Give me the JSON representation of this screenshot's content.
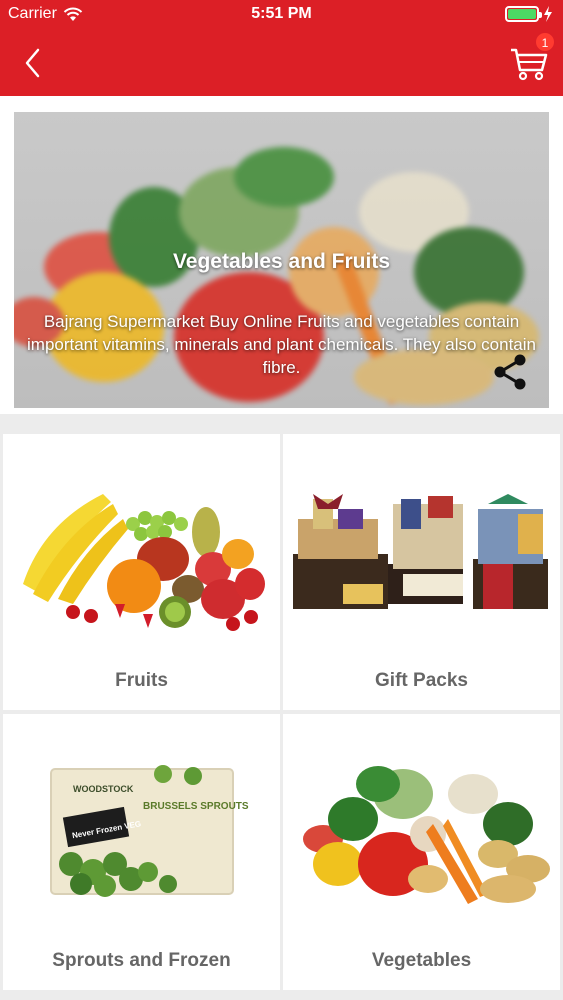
{
  "status_bar": {
    "carrier": "Carrier",
    "time": "5:51 PM",
    "icons": [
      "wifi-icon",
      "battery-icon",
      "charging-icon"
    ]
  },
  "nav": {
    "back_icon": "chevron-left-icon",
    "cart_icon": "cart-icon",
    "cart_badge": "1",
    "bar_color": "#dc1f26"
  },
  "banner": {
    "title": "Vegetables and Fruits",
    "description": "Bajrang Supermarket Buy Online Fruits and vegetables contain important vitamins, minerals and plant chemicals. They also contain fibre.",
    "share_icon": "share-icon"
  },
  "categories": [
    {
      "label": "Fruits",
      "image": "fruits-image"
    },
    {
      "label": "Gift Packs",
      "image": "gift-packs-image"
    },
    {
      "label": "Sprouts and Frozen",
      "image": "brussels-sprouts-package-image"
    },
    {
      "label": "Vegetables",
      "image": "vegetables-image"
    }
  ],
  "product_image_text": {
    "brand": "WOODSTOCK",
    "product": "BRUSSELS SPROUTS",
    "tag": "Never Frozen VEGGIES!"
  }
}
